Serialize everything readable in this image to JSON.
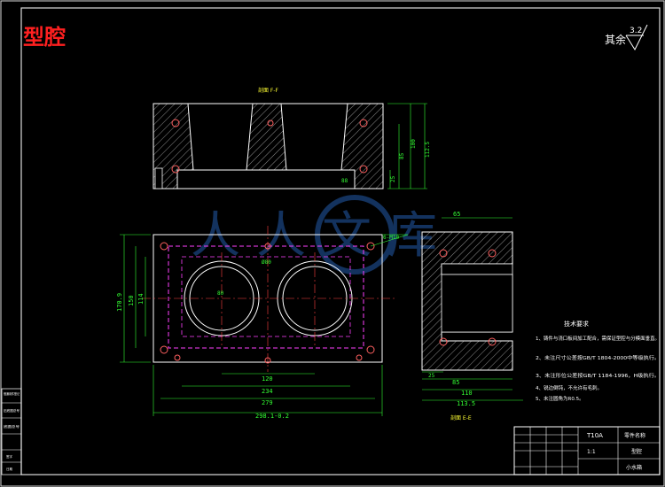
{
  "title": "型腔",
  "roughness": {
    "prefix": "其余",
    "value": "3.2"
  },
  "sections": {
    "ff": "剖面 F-F",
    "ee": "剖面 E-E"
  },
  "watermark": "人人文库",
  "dims_plan": {
    "w298": "298.1-0.2",
    "w279": "279",
    "w234": "234",
    "w120": "120",
    "w80": "80",
    "h1709": "170.9",
    "h150": "150",
    "h114": "114",
    "hole": "6-M10",
    "dia": "Ø80"
  },
  "dims_ff": {
    "h100": "100",
    "h85": "85",
    "h25": "25",
    "h1125": "112.5",
    "ref": "88"
  },
  "dims_ee": {
    "w65": "65",
    "w85": "85",
    "w110": "110",
    "w1135": "113.5",
    "w25": "25"
  },
  "notes": {
    "heading": "技术要求",
    "items": [
      "1、铸件与浇口板间加工配合，需保证型腔与分模面垂直。",
      "2、未注尺寸公差按GB/T 1804-2000中等级执行。",
      "3、未注形位公差按GB/T 1184-1996，H级执行。",
      "4、锐边倒钝，不允许有毛刺。",
      "5、未注圆角为R0.5。"
    ]
  },
  "title_block": {
    "c1": "T10A",
    "c2": "零件名称",
    "c3": "型腔",
    "c4": "1:1",
    "c5": "小水箱"
  },
  "left_strip": [
    "借通用件登记",
    "旧底图总号",
    "底图总号",
    "签字",
    "日期"
  ]
}
